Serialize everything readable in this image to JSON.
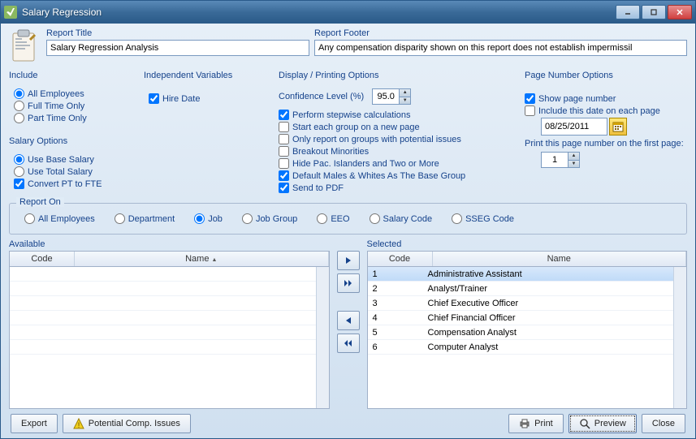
{
  "window": {
    "title": "Salary Regression"
  },
  "report": {
    "title_label": "Report Title",
    "title_value": "Salary Regression Analysis",
    "footer_label": "Report Footer",
    "footer_value": "Any compensation disparity shown on this report does not establish impermissil"
  },
  "include": {
    "group_label": "Include",
    "all": "All Employees",
    "full": "Full Time Only",
    "part": "Part Time Only",
    "selected": "all"
  },
  "independent": {
    "group_label": "Independent Variables",
    "hire_date": "Hire Date",
    "hire_date_checked": true
  },
  "salary_options": {
    "group_label": "Salary Options",
    "base": "Use Base Salary",
    "total": "Use Total Salary",
    "convert": "Convert PT to FTE",
    "selected": "base",
    "convert_checked": true
  },
  "display": {
    "group_label": "Display / Printing Options",
    "confidence_label": "Confidence Level (%)",
    "confidence_value": "95.0",
    "opts": [
      {
        "label": "Perform stepwise calculations",
        "checked": true
      },
      {
        "label": "Start each group on a new page",
        "checked": false
      },
      {
        "label": "Only report on groups with potential issues",
        "checked": false
      },
      {
        "label": "Breakout Minorities",
        "checked": false
      },
      {
        "label": "Hide Pac. Islanders and Two or More",
        "checked": false
      },
      {
        "label": "Default Males & Whites As The Base Group",
        "checked": true
      },
      {
        "label": "Send to PDF",
        "checked": true
      }
    ]
  },
  "page_number": {
    "group_label": "Page Number Options",
    "show": "Show page number",
    "show_checked": true,
    "include_date": "Include this date on each page",
    "include_date_checked": false,
    "date_value": "08/25/2011",
    "print_first_label": "Print this page number on the first page:",
    "print_first_value": "1"
  },
  "report_on": {
    "group_label": "Report On",
    "options": [
      "All Employees",
      "Department",
      "Job",
      "Job Group",
      "EEO",
      "Salary Code",
      "SSEG Code"
    ],
    "selected": "Job"
  },
  "lists": {
    "available_label": "Available",
    "selected_label": "Selected",
    "col_code": "Code",
    "col_name": "Name",
    "available": [],
    "selected": [
      {
        "code": "1",
        "name": "Administrative Assistant",
        "highlighted": true
      },
      {
        "code": "2",
        "name": "Analyst/Trainer",
        "highlighted": false
      },
      {
        "code": "3",
        "name": "Chief Executive Officer",
        "highlighted": false
      },
      {
        "code": "4",
        "name": "Chief Financial Officer",
        "highlighted": false
      },
      {
        "code": "5",
        "name": "Compensation Analyst",
        "highlighted": false
      },
      {
        "code": "6",
        "name": "Computer Analyst",
        "highlighted": false
      }
    ]
  },
  "buttons": {
    "export": "Export",
    "potential": "Potential Comp. Issues",
    "print": "Print",
    "preview": "Preview",
    "close": "Close"
  }
}
